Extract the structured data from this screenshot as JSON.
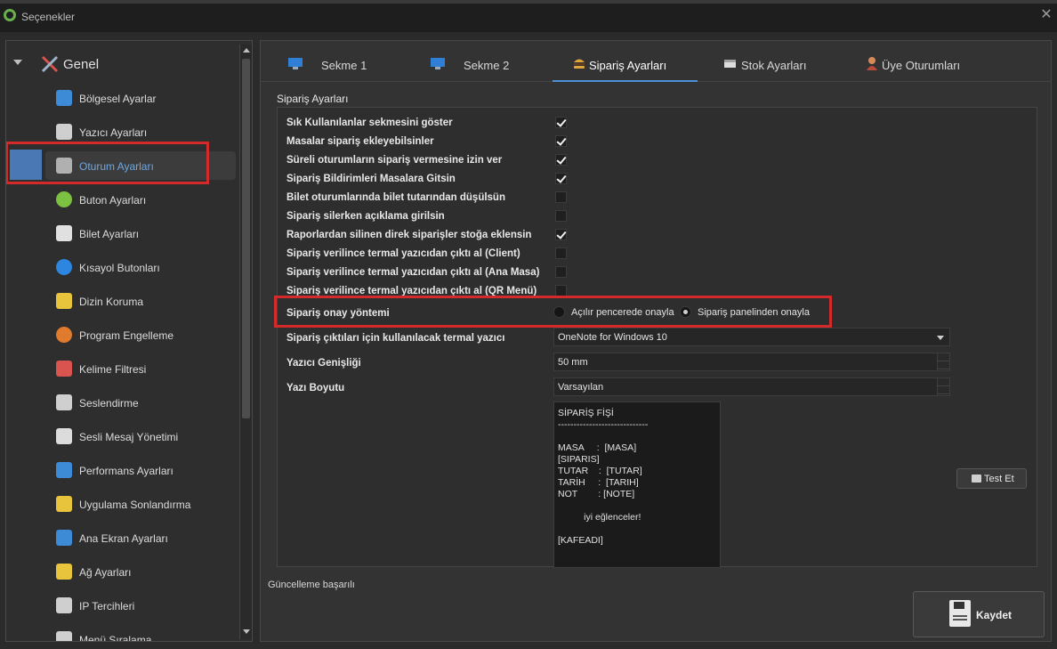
{
  "window": {
    "title": "Seçenekler"
  },
  "sidebar": {
    "root_label": "Genel",
    "items": [
      {
        "label": "Bölgesel Ayarlar",
        "icon": "globe-icon",
        "color": "#3d8bd6"
      },
      {
        "label": "Yazıcı Ayarları",
        "icon": "printer-icon",
        "color": "#cfcfcf"
      },
      {
        "label": "Oturum Ayarları",
        "icon": "tools-icon",
        "color": "#b0b0b0",
        "selected": true
      },
      {
        "label": "Buton Ayarları",
        "icon": "checkmark-icon",
        "color": "#7cc142"
      },
      {
        "label": "Bilet Ayarları",
        "icon": "ticket-icon",
        "color": "#e0e0e0"
      },
      {
        "label": "Kısayol Butonları",
        "icon": "play-icon",
        "color": "#2d86e0"
      },
      {
        "label": "Dizin Koruma",
        "icon": "folder-shield-icon",
        "color": "#e8c43c"
      },
      {
        "label": "Program Engelleme",
        "icon": "block-icon",
        "color": "#e07a2d"
      },
      {
        "label": "Kelime Filtresi",
        "icon": "filter-icon",
        "color": "#d9534f"
      },
      {
        "label": "Seslendirme",
        "icon": "speaker-icon",
        "color": "#cfcfcf"
      },
      {
        "label": "Sesli Mesaj Yönetimi",
        "icon": "microphone-globe-icon",
        "color": "#dcdcdc"
      },
      {
        "label": "Performans Ayarları",
        "icon": "performance-icon",
        "color": "#3d8bd6"
      },
      {
        "label": "Uygulama Sonlandırma",
        "icon": "broom-icon",
        "color": "#e8c43c"
      },
      {
        "label": "Ana Ekran Ayarları",
        "icon": "monitor-icon",
        "color": "#3d8bd6"
      },
      {
        "label": "Ağ Ayarları",
        "icon": "network-icon",
        "color": "#e8c43c"
      },
      {
        "label": "IP Tercihleri",
        "icon": "ip-icon",
        "color": "#cfcfcf"
      },
      {
        "label": "Menü Sıralama",
        "icon": "grid-icon",
        "color": "#cfcfcf"
      }
    ]
  },
  "tabs": [
    {
      "label": "Sekme 1",
      "icon": "monitor-icon",
      "color": "#2f7fd6"
    },
    {
      "label": "Sekme 2",
      "icon": "monitor-icon",
      "color": "#2f7fd6"
    },
    {
      "label": "Sipariş Ayarları",
      "icon": "burger-icon",
      "color": "#e0a63a",
      "active": true
    },
    {
      "label": "Stok Ayarları",
      "icon": "box-icon",
      "color": "#dcdcdc"
    },
    {
      "label": "Üye Oturumları",
      "icon": "user-icon",
      "color": "#d88b5a"
    }
  ],
  "section_title": "Sipariş Ayarları",
  "options": [
    {
      "label": "Sık Kullanılanlar sekmesini göster",
      "checked": true
    },
    {
      "label": "Masalar sipariş ekleyebilsinler",
      "checked": true
    },
    {
      "label": "Süreli oturumların sipariş vermesine izin ver",
      "checked": true
    },
    {
      "label": "Sipariş Bildirimleri Masalara Gitsin",
      "checked": true
    },
    {
      "label": "Bilet oturumlarında bilet tutarından düşülsün",
      "checked": false
    },
    {
      "label": "Sipariş silerken açıklama girilsin",
      "checked": false
    },
    {
      "label": "Raporlardan silinen direk siparişler stoğa eklensin",
      "checked": true
    },
    {
      "label": "Sipariş verilince termal yazıcıdan çıktı al (Client)",
      "checked": false
    },
    {
      "label": "Sipariş verilince termal yazıcıdan çıktı al (Ana Masa)",
      "checked": false
    },
    {
      "label": "Sipariş verilince termal yazıcıdan çıktı al (QR Menü)",
      "checked": false
    }
  ],
  "approval": {
    "label": "Sipariş onay yöntemi",
    "option_a": "Açılır pencerede onayla",
    "option_b": "Sipariş panelinden onayla",
    "selected": "option_b"
  },
  "printer": {
    "label": "Sipariş çıktıları için kullanılacak termal yazıcı",
    "value": "OneNote for Windows 10"
  },
  "printer_width": {
    "label": "Yazıcı Genişliği",
    "value": "50 mm"
  },
  "font_size": {
    "label": "Yazı Boyutu",
    "value": "Varsayılan"
  },
  "receipt_template": "SİPARİŞ FİŞİ\n-----------------------------\n\nMASA     :  [MASA]\n[SIPARIS]\nTUTAR    :  [TUTAR]\nTARİH     :  [TARIH]\nNOT        : [NOTE]\n\n          iyi eğlenceler!\n\n[KAFEADI]",
  "test_button": "Test Et",
  "status_text": "Güncelleme başarılı",
  "save_button": "Kaydet",
  "colors": {
    "accent": "#4a90d9",
    "highlight_box": "#d42a2a",
    "selected_marker": "#4a78b5"
  }
}
